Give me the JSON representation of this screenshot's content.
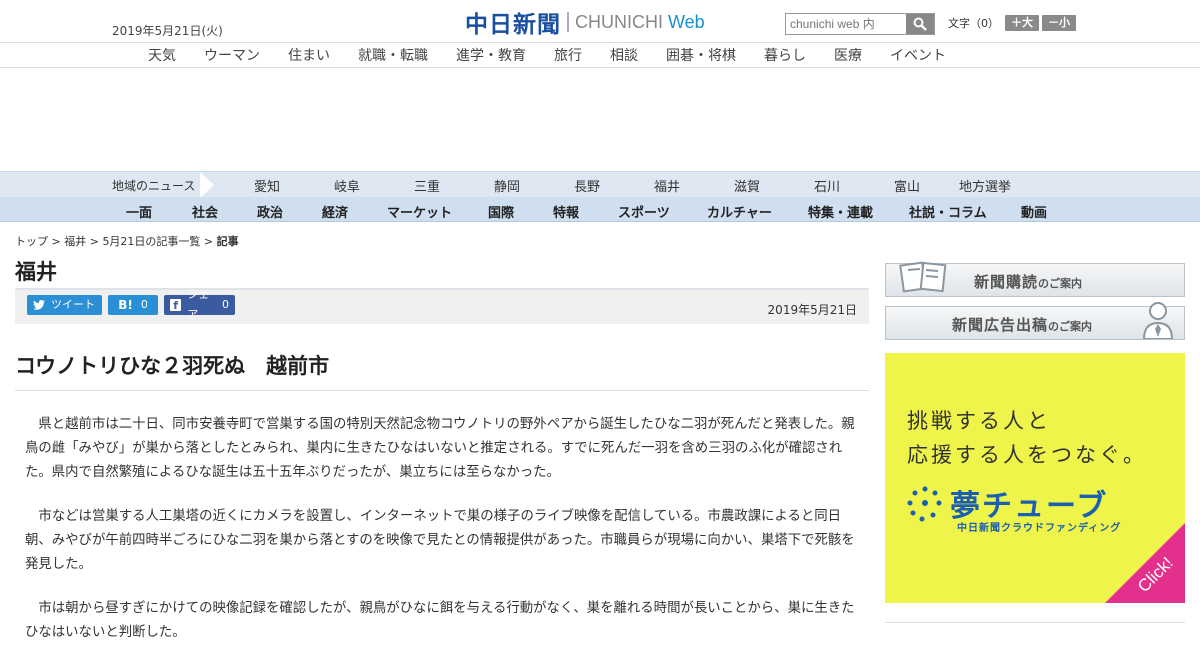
{
  "header": {
    "date": "2019年5月21日(火)",
    "logo_ja": "中日新聞",
    "logo_en": "CHUNICHI",
    "logo_web": "Web",
    "search_placeholder": "chunichi web 内",
    "fontsize_label": "文字（0）",
    "fontsize_larger": "＋大",
    "fontsize_smaller": "－小"
  },
  "categories": [
    "天気",
    "ウーマン",
    "住まい",
    "就職・転職",
    "進学・教育",
    "旅行",
    "相談",
    "囲碁・将棋",
    "暮らし",
    "医療",
    "イベント"
  ],
  "region_bar": {
    "title": "地域のニュース",
    "regions": [
      "愛知",
      "岐阜",
      "三重",
      "静岡",
      "長野",
      "福井",
      "滋賀",
      "石川",
      "富山",
      "地方選挙"
    ]
  },
  "sections": [
    "一面",
    "社会",
    "政治",
    "経済",
    "マーケット",
    "国際",
    "特報",
    "スポーツ",
    "カルチャー",
    "特集・連載",
    "社説・コラム",
    "動画"
  ],
  "breadcrumb": [
    "トップ",
    "福井",
    "5月21日の記事一覧",
    "記事"
  ],
  "page_title": "福井",
  "share": {
    "tweet_label": "ツイート",
    "hatena_label": "B!",
    "hatena_count": "0",
    "fb_label": "シェア",
    "fb_count": "0",
    "date": "2019年5月21日"
  },
  "article": {
    "headline": "コウノトリひな２羽死ぬ　越前市",
    "paragraphs": [
      "県と越前市は二十日、同市安養寺町で営巣する国の特別天然記念物コウノトリの野外ペアから誕生したひな二羽が死んだと発表した。親鳥の雌「みやび」が巣から落としたとみられ、巣内に生きたひなはいないと推定される。すでに死んだ一羽を含め三羽のふ化が確認された。県内で自然繁殖によるひな誕生は五十五年ぶりだったが、巣立ちには至らなかった。",
      "市などは営巣する人工巣塔の近くにカメラを設置し、インターネットで巣の様子のライブ映像を配信している。市農政課によると同日朝、みやびが午前四時半ごろにひな二羽を巣から落とすのを映像で見たとの情報提供があった。市職員らが現場に向かい、巣塔下で死骸を発見した。",
      "市は朝から昼すぎにかけての映像記録を確認したが、親鳥がひなに餌を与える行動がなく、巣を離れる時間が長いことから、巣に生きたひなはいないと判断した。"
    ]
  },
  "sidebar": {
    "subscribe_main": "新聞購読",
    "subscribe_sub": "のご案内",
    "ad_main": "新聞広告出稿",
    "ad_sub": "のご案内",
    "banner_line1": "挑戦する人と",
    "banner_line2": "応援する人をつなぐ。",
    "banner_brand": "夢チューブ",
    "banner_sub": "中日新聞クラウドファンディング",
    "banner_click": "Click!"
  },
  "colors": {
    "brand_blue": "#1a4fa0",
    "region_bar_bg": "#dfe8f2",
    "section_bar_bg": "#cfdff0",
    "twitter": "#2b8fd5",
    "facebook": "#3b5ba0",
    "banner_yellow": "#eef44a",
    "banner_magenta": "#e4308d"
  }
}
